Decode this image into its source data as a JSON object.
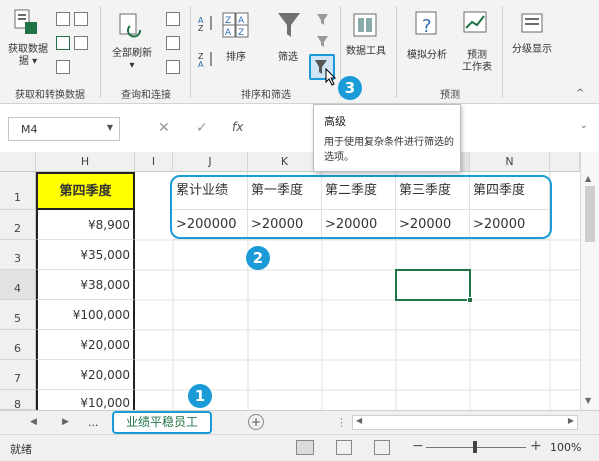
{
  "ribbon": {
    "get_data": "获取数据",
    "get_data_line2": "据 ▾",
    "refresh_all": "全部刷新",
    "refresh_caret": "▾",
    "sort": "排序",
    "filter": "筛选",
    "data_tools": "数据工具",
    "what_if": "模拟分析",
    "forecast_sheet": "预测",
    "forecast_sheet_line2": "工作表",
    "outline": "分级显示",
    "groups": {
      "get_transform": "获取和转换数据",
      "queries": "查询和连接",
      "sort_filter": "排序和筛选",
      "forecast": "预测"
    }
  },
  "formula_bar": {
    "name_box": "M4",
    "fx": "fx"
  },
  "tooltip": {
    "title": "高级",
    "description": "用于使用复杂条件进行筛选的选项。"
  },
  "sheet": {
    "columns": [
      "H",
      "I",
      "J",
      "K",
      "L",
      "M",
      "N"
    ],
    "rows": [
      "1",
      "2",
      "3",
      "4",
      "5",
      "6",
      "7",
      "8"
    ],
    "h_values": [
      "第四季度",
      "¥8,900",
      "¥35,000",
      "¥38,000",
      "¥100,000",
      "¥20,000",
      "¥20,000",
      "¥10,000"
    ],
    "criteria_headers": [
      "累计业绩",
      "第一季度",
      "第二季度",
      "第三季度",
      "第四季度"
    ],
    "criteria_values": [
      ">200000",
      ">20000",
      ">20000",
      ">20000",
      ">20000"
    ]
  },
  "tabs": {
    "ellipsis": "...",
    "active_sheet": "业绩平稳员工",
    "add": "+"
  },
  "status": {
    "ready": "就绪",
    "zoom": "100%"
  },
  "badges": {
    "one": "1",
    "two": "2",
    "three": "3"
  },
  "colors": {
    "highlight_yellow": "#ffff00",
    "callout_blue": "#1a9bd7",
    "excel_green": "#217346"
  }
}
